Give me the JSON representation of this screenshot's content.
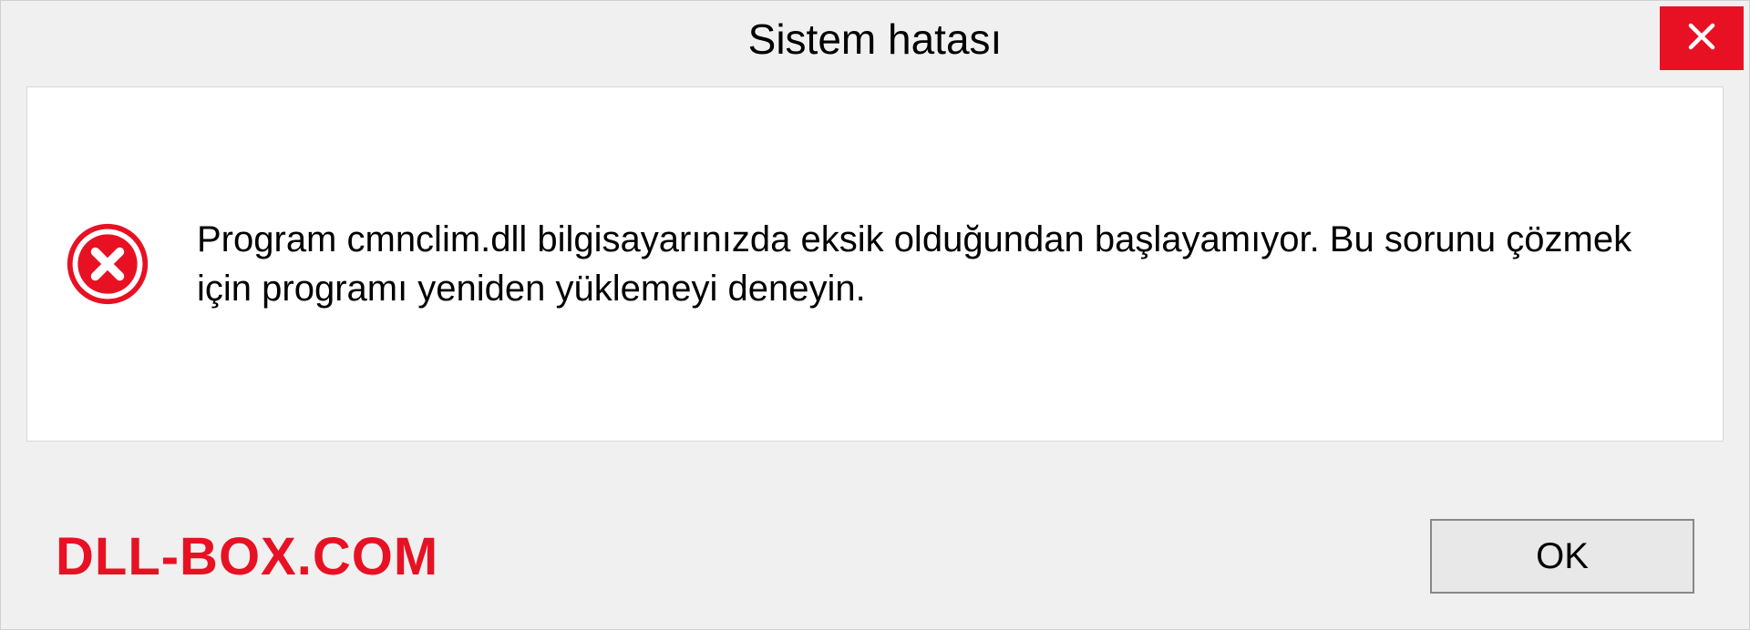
{
  "titlebar": {
    "title": "Sistem hatası"
  },
  "content": {
    "message": "Program cmnclim.dll bilgisayarınızda eksik olduğundan başlayamıyor. Bu sorunu çözmek için programı yeniden yüklemeyi deneyin."
  },
  "footer": {
    "watermark": "DLL-BOX.COM",
    "ok_label": "OK"
  },
  "icons": {
    "close": "close-icon",
    "error": "error-circle-x-icon"
  },
  "colors": {
    "accent_red": "#e81123",
    "window_bg": "#f0f0f0",
    "panel_bg": "#ffffff"
  }
}
